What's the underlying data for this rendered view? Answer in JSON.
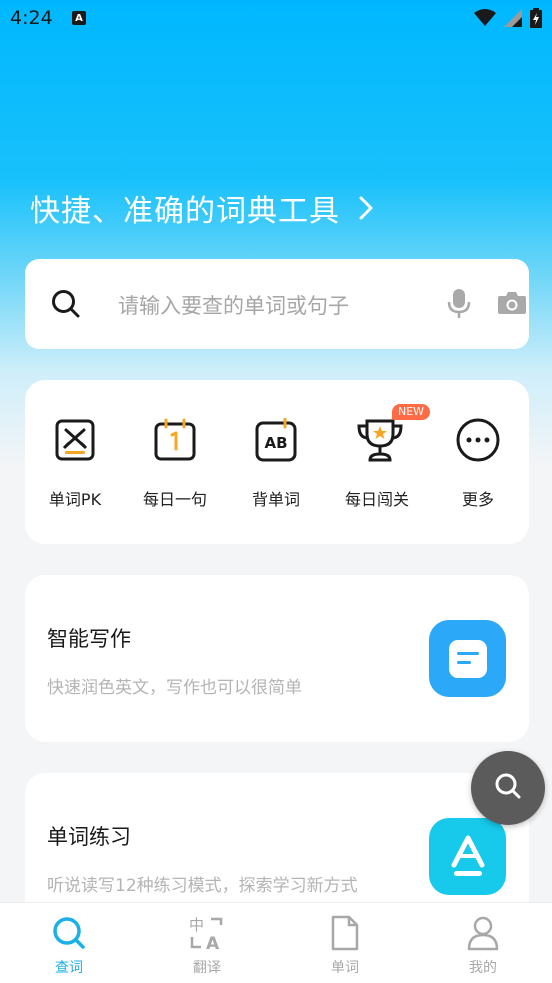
{
  "status_bar": {
    "time": "4:24",
    "app_icon_letter": "A"
  },
  "hero": {
    "slogan": "快捷、准确的词典工具"
  },
  "search": {
    "placeholder": "请输入要查的单词或句子"
  },
  "features": {
    "items": [
      {
        "label": "单词PK",
        "icon": "sword-pk-icon"
      },
      {
        "label": "每日一句",
        "icon": "calendar-icon"
      },
      {
        "label": "背单词",
        "icon": "ab-card-icon"
      },
      {
        "label": "每日闯关",
        "icon": "trophy-icon"
      },
      {
        "label": "更多",
        "icon": "more-dots-icon"
      }
    ],
    "new_badge": "NEW"
  },
  "cards": [
    {
      "title": "智能写作",
      "subtitle": "快速润色英文，写作也可以很简单",
      "icon": "document-lines-icon",
      "color": "#2ba8f7"
    },
    {
      "title": "单词练习",
      "subtitle": "听说读写12种练习模式，探索学习新方式",
      "icon": "letter-a-icon",
      "color": "#17c9ea"
    }
  ],
  "tabbar": {
    "items": [
      {
        "label": "查词",
        "icon": "search-icon",
        "active": true
      },
      {
        "label": "翻译",
        "icon": "translate-icon",
        "active": false
      },
      {
        "label": "单词",
        "icon": "document-icon",
        "active": false
      },
      {
        "label": "我的",
        "icon": "profile-icon",
        "active": false
      }
    ]
  },
  "colors": {
    "accent": "#1ab0e8",
    "hero_top": "#00b7ff",
    "fab": "#5b5b5b",
    "badge": "#ff6b45"
  }
}
